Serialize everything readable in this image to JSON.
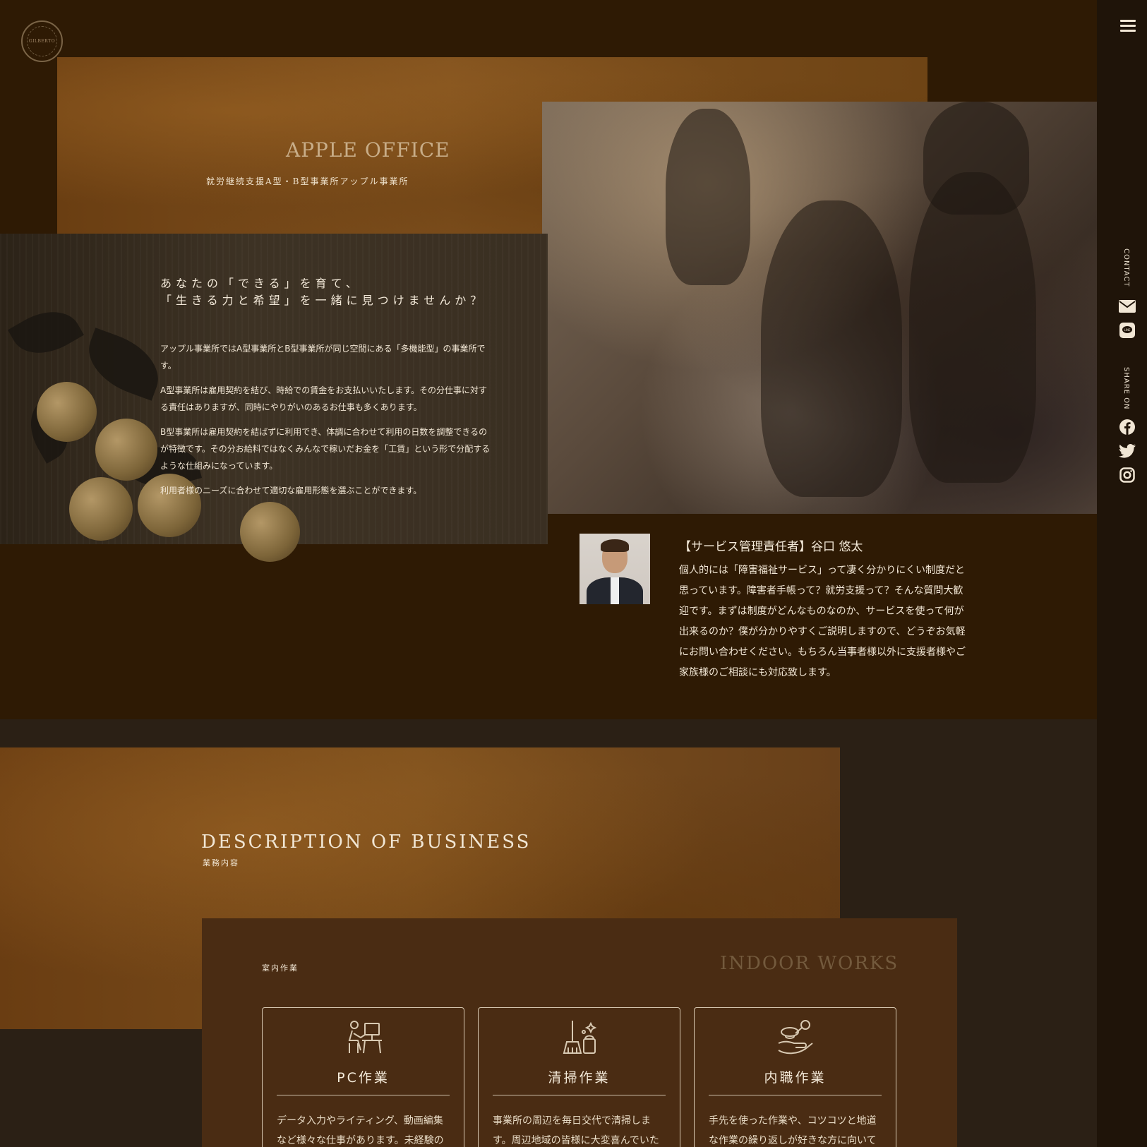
{
  "header": {
    "logo_text": "GILBERTO"
  },
  "hero": {
    "title": "APPLE OFFICE",
    "subtitle": "就労継続支援A型・B型事業所アップル事業所"
  },
  "intro": {
    "heading_line1": "あなたの「できる」を育て、",
    "heading_line2": "「生きる力と希望」を一緒に見つけませんか？",
    "paragraphs": [
      "アップル事業所ではA型事業所とB型事業所が同じ空間にある「多機能型」の事業所です。",
      "A型事業所は雇用契約を結び、時給での賃金をお支払いいたします。その分仕事に対する責任はありますが、同時にやりがいのあるお仕事も多くあります。",
      "B型事業所は雇用契約を結ばずに利用でき、体調に合わせて利用の日数を調整できるのが特徴です。その分お給料ではなくみんなで稼いだお金を「工賃」という形で分配するような仕組みになっています。",
      "利用者様のニーズに合わせて適切な雇用形態を選ぶことができます。"
    ]
  },
  "manager": {
    "title": "【サービス管理責任者】谷口 悠太",
    "message": "個人的には「障害福祉サービス」って凄く分かりにくい制度だと思っています。障害者手帳って？就労支援って？そんな質問大歓迎です。まずは制度がどんなものなのか、サービスを使って何が出来るのか？僕が分かりやすくご説明しますので、どうぞお気軽にお問い合わせください。もちろん当事者様以外に支援者様やご家族様のご相談にも対応致します。"
  },
  "sidebar": {
    "contact_label": "CONTACT",
    "share_label": "SHARE ON",
    "icons": [
      "menu-icon",
      "mail-icon",
      "line-icon",
      "facebook-icon",
      "twitter-icon",
      "instagram-icon"
    ]
  },
  "business": {
    "title": "DESCRIPTION OF BUSINESS",
    "subtitle": "業務内容",
    "section_jp": "室内作業",
    "section_en": "INDOOR WORKS",
    "cards": [
      {
        "icon": "pc-work-icon",
        "title": "PC作業",
        "text": "データ入力やライティング、動画編集など様々な仕事があります。未経験の"
      },
      {
        "icon": "cleaning-icon",
        "title": "清掃作業",
        "text": "事業所の周辺を毎日交代で清掃します。周辺地域の皆様に大変喜んでいた"
      },
      {
        "icon": "handwork-icon",
        "title": "内職作業",
        "text": "手先を使った作業や、コツコツと地道な作業の繰り返しが好きな方に向いて"
      }
    ]
  },
  "colors": {
    "page_background": "#2e1a04",
    "accent_band": "#7c4f1d",
    "works_panel": "#4a2c13",
    "text": "#f1e6d4",
    "muted_heading": "#735a3d"
  }
}
